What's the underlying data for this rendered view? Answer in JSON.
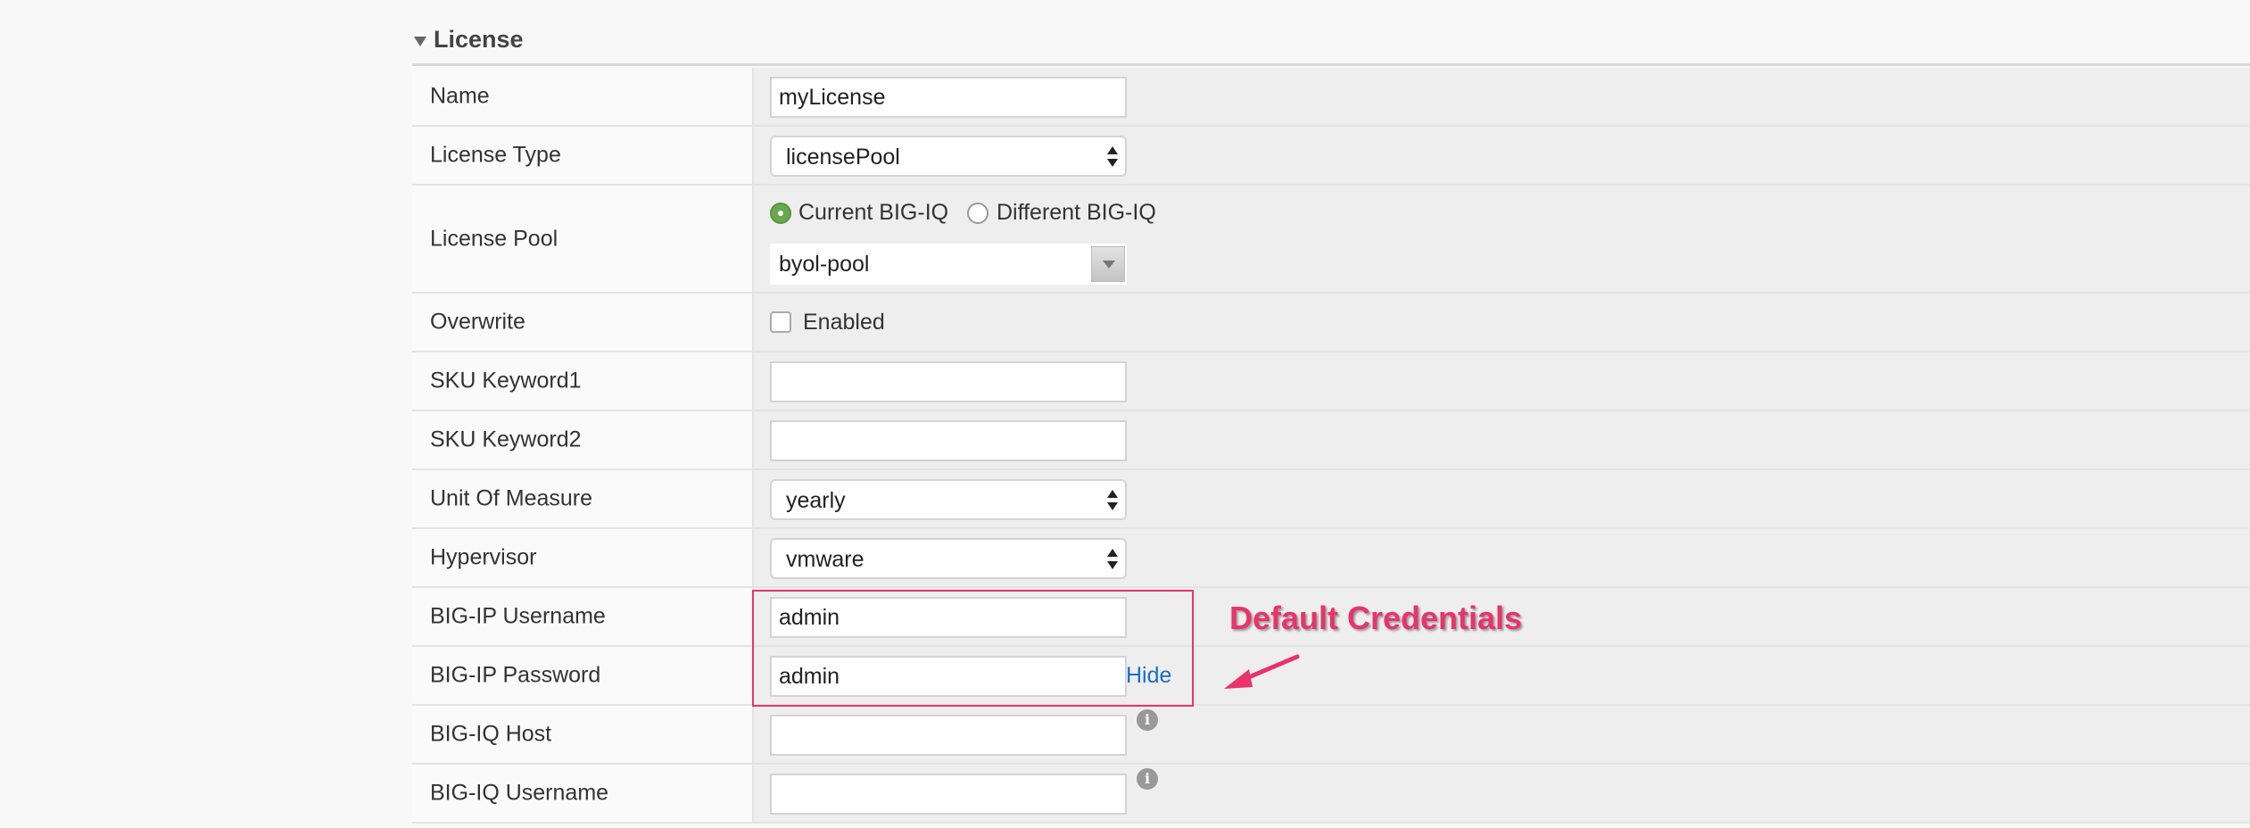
{
  "section": {
    "title": "License"
  },
  "fields": {
    "name": {
      "label": "Name",
      "value": "myLicense"
    },
    "license_type": {
      "label": "License Type",
      "value": "licensePool"
    },
    "license_pool": {
      "label": "License Pool",
      "options": [
        "Current BIG-IQ",
        "Different BIG-IQ"
      ],
      "selected": "Current BIG-IQ",
      "pool_value": "byol-pool"
    },
    "overwrite": {
      "label": "Overwrite",
      "checkbox_label": "Enabled",
      "checked": false
    },
    "sku_keyword1": {
      "label": "SKU Keyword1",
      "value": ""
    },
    "sku_keyword2": {
      "label": "SKU Keyword2",
      "value": ""
    },
    "unit_of_measure": {
      "label": "Unit Of Measure",
      "value": "yearly"
    },
    "hypervisor": {
      "label": "Hypervisor",
      "value": "vmware"
    },
    "bigip_username": {
      "label": "BIG-IP Username",
      "value": "admin"
    },
    "bigip_password": {
      "label": "BIG-IP Password",
      "value": "admin",
      "toggle_label": "Hide"
    },
    "bigiq_host": {
      "label": "BIG-IQ Host",
      "value": "",
      "info_icon": "info-icon"
    },
    "bigiq_username": {
      "label": "BIG-IQ Username",
      "value": "",
      "info_icon": "info-icon"
    }
  },
  "annotation": {
    "text": "Default Credentials",
    "color": "#e8336b"
  },
  "colors": {
    "radio_selected": "#6aa84f",
    "link": "#1a6fc4",
    "label_bg": "#fafafa",
    "value_bg": "#eeeeee"
  }
}
